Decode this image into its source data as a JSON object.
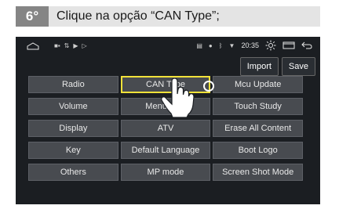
{
  "step": {
    "number": "6°",
    "instruction": "Clique na opção “CAN Type”;"
  },
  "status_bar": {
    "time": "20:35",
    "left_icons": [
      "home-outline-icon",
      "media-icon",
      "usb-icon",
      "play-icon",
      "play-outline-icon"
    ],
    "right_icons": [
      "sim-icon",
      "location-icon",
      "bluetooth-icon",
      "wifi-icon",
      "brightness-icon",
      "recents-icon",
      "back-icon"
    ]
  },
  "toolbar": {
    "import_label": "Import",
    "save_label": "Save"
  },
  "menu": {
    "items": [
      {
        "label": "Radio"
      },
      {
        "label": "CAN Type"
      },
      {
        "label": "Mcu Update"
      },
      {
        "label": "Volume"
      },
      {
        "label": "Menu Icon"
      },
      {
        "label": "Touch Study"
      },
      {
        "label": "Display"
      },
      {
        "label": "ATV"
      },
      {
        "label": "Erase All Content"
      },
      {
        "label": "Key"
      },
      {
        "label": "Default Language"
      },
      {
        "label": "Boot Logo"
      },
      {
        "label": "Others"
      },
      {
        "label": "MP mode"
      },
      {
        "label": "Screen Shot Mode"
      }
    ],
    "highlighted_item": "CAN Type"
  },
  "colors": {
    "highlight": "#f2e23a",
    "tile_bg": "#484b50",
    "screen_bg": "#1b1e22",
    "step_badge": "#858585"
  }
}
